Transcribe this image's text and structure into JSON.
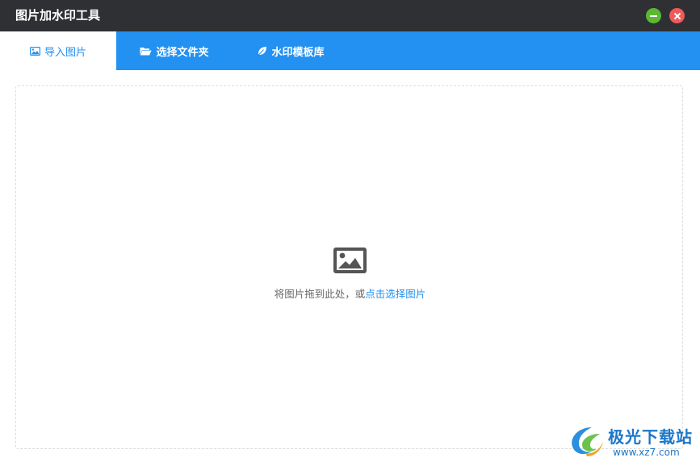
{
  "window": {
    "title": "图片加水印工具"
  },
  "tabs": [
    {
      "label": "导入图片",
      "icon": "image-icon",
      "active": true
    },
    {
      "label": "选择文件夹",
      "icon": "folder-open-icon",
      "active": false
    },
    {
      "label": "水印模板库",
      "icon": "leaf-icon",
      "active": false
    }
  ],
  "dropzone": {
    "icon": "image-icon",
    "hint_prefix": "将图片拖到此处，或",
    "hint_link": "点击选择图片"
  },
  "watermark_logo": {
    "name": "极光下载站",
    "url": "www.xz7.com"
  },
  "colors": {
    "titlebar": "#2f3033",
    "tabbar": "#2291f1",
    "link": "#2291f1",
    "minimize": "#5cb832",
    "close": "#f05a5a"
  }
}
